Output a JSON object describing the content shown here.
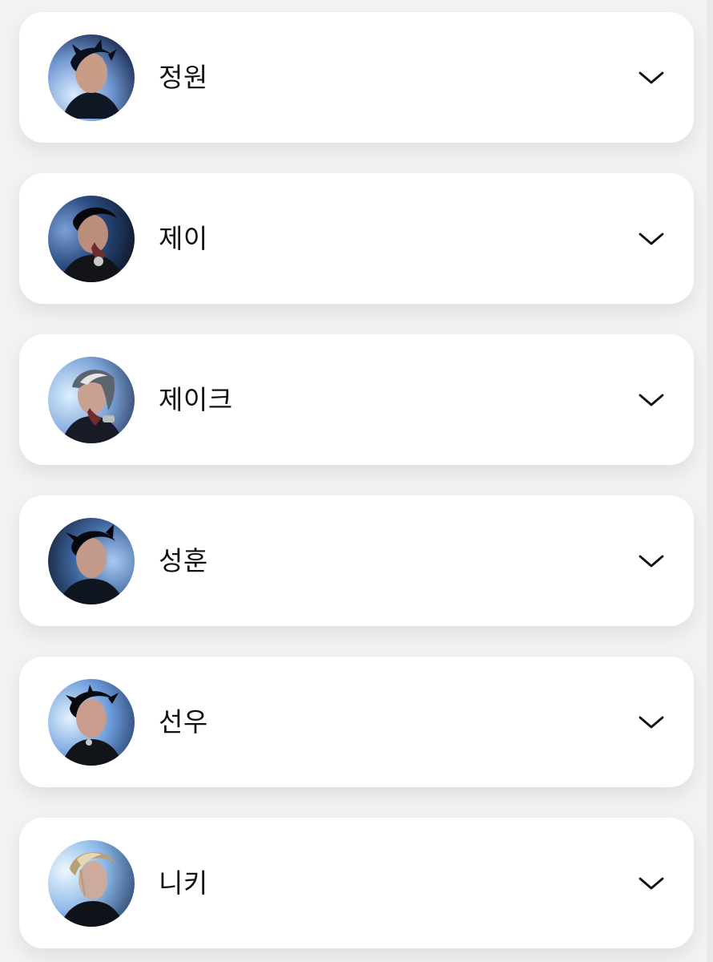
{
  "members": [
    {
      "name": "정원",
      "avatar_bg": "#5e86c7"
    },
    {
      "name": "제이",
      "avatar_bg": "#2b3f63"
    },
    {
      "name": "제이크",
      "avatar_bg": "#7ca7da"
    },
    {
      "name": "성훈",
      "avatar_bg": "#3d5d91"
    },
    {
      "name": "선우",
      "avatar_bg": "#6f9ed8"
    },
    {
      "name": "니키",
      "avatar_bg": "#8bb8e6"
    }
  ],
  "icons": {
    "expand": "chevron-down-icon",
    "avatar": "profile-photo"
  },
  "colors": {
    "background": "#f2f2f2",
    "card": "#ffffff",
    "text": "#111111"
  }
}
